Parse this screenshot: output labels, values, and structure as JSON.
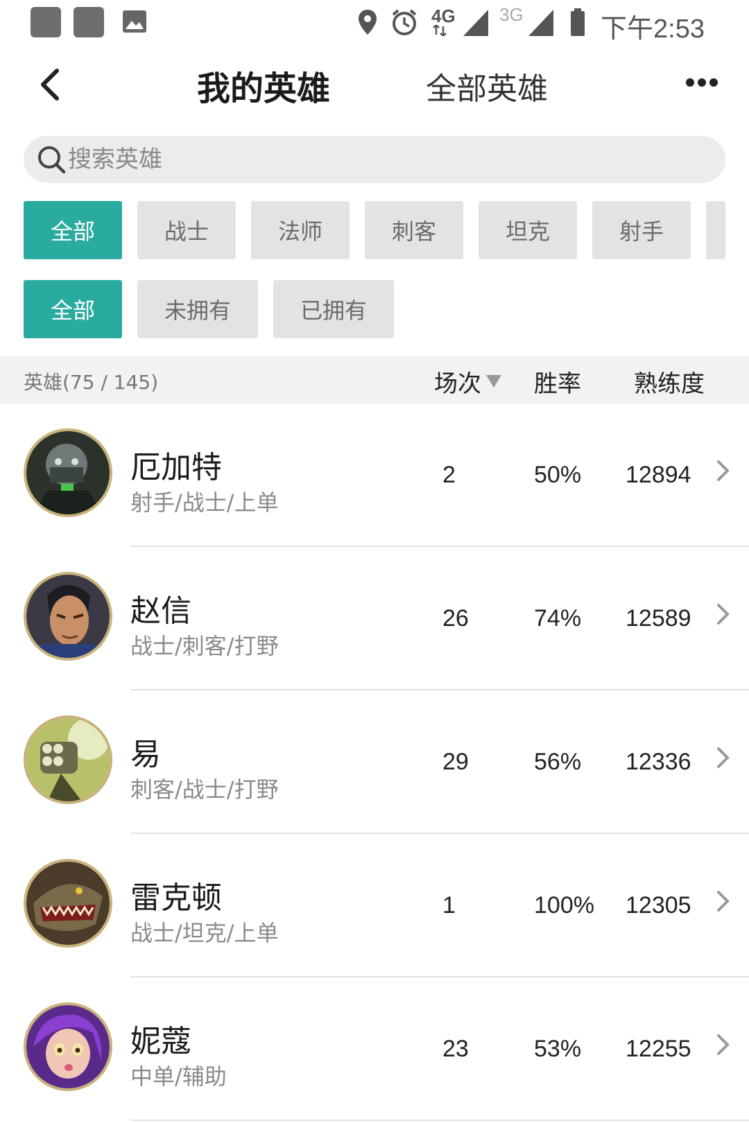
{
  "status_bar": {
    "time": "下午2:53",
    "network_4g": "4G",
    "network_3g": "3G"
  },
  "nav": {
    "title_mine": "我的英雄",
    "title_all": "全部英雄"
  },
  "search": {
    "placeholder": "搜索英雄",
    "value": ""
  },
  "role_filters": [
    "全部",
    "战士",
    "法师",
    "刺客",
    "坦克",
    "射手"
  ],
  "own_filters": [
    "全部",
    "未拥有",
    "已拥有"
  ],
  "accent_color": "#2aab9f",
  "list_header": {
    "count": "英雄(75 / 145)",
    "matches": "场次",
    "win_rate": "胜率",
    "proficiency": "熟练度"
  },
  "heroes": [
    {
      "name": "厄加特",
      "roles": "射手/战士/上单",
      "matches": "2",
      "win_rate": "50%",
      "proficiency": "12894"
    },
    {
      "name": "赵信",
      "roles": "战士/刺客/打野",
      "matches": "26",
      "win_rate": "74%",
      "proficiency": "12589"
    },
    {
      "name": "易",
      "roles": "刺客/战士/打野",
      "matches": "29",
      "win_rate": "56%",
      "proficiency": "12336"
    },
    {
      "name": "雷克顿",
      "roles": "战士/坦克/上单",
      "matches": "1",
      "win_rate": "100%",
      "proficiency": "12305"
    },
    {
      "name": "妮蔻",
      "roles": "中单/辅助",
      "matches": "23",
      "win_rate": "53%",
      "proficiency": "12255"
    }
  ]
}
